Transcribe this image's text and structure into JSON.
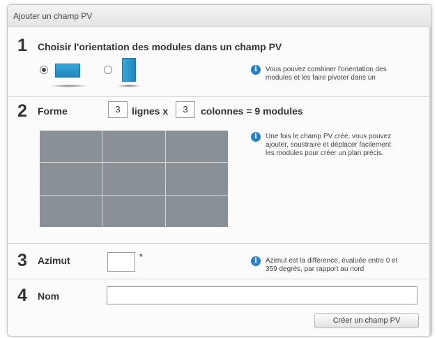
{
  "dialog": {
    "title": "Ajouter un champ PV"
  },
  "section1": {
    "number": "1",
    "title": "Choisir l'orientation des modules dans un champ PV",
    "selected_orientation": "landscape",
    "info_lines": [
      "Vous pouvez combiner l'orientation des",
      "modules et les faire pivoter dans un"
    ]
  },
  "section2": {
    "number": "2",
    "label": "Forme",
    "rows": "3",
    "rows_label": "lignes x",
    "cols": "3",
    "result_label": "colonnes = 9 modules",
    "info_lines": [
      "Une fois le champ PV créé, vous pouvez",
      "ajouter, soustraire et déplacer facilement",
      "les modules pour créer un plan précis."
    ]
  },
  "section3": {
    "number": "3",
    "label": "Azimut",
    "value": "",
    "unit": "°",
    "info_lines": [
      "Azimut est la différence, évaluée entre 0 et",
      "359 degrés, par rapport au nord"
    ]
  },
  "section4": {
    "number": "4",
    "label": "Nom",
    "value": "",
    "button_label": "Créer un champ PV"
  },
  "icons": {
    "info": "info-icon",
    "landscape": "module-landscape-icon",
    "portrait": "module-portrait-icon"
  },
  "colors": {
    "module": "#1f86bd",
    "info": "#2a80c4",
    "grid_cell": "#8a9196"
  }
}
